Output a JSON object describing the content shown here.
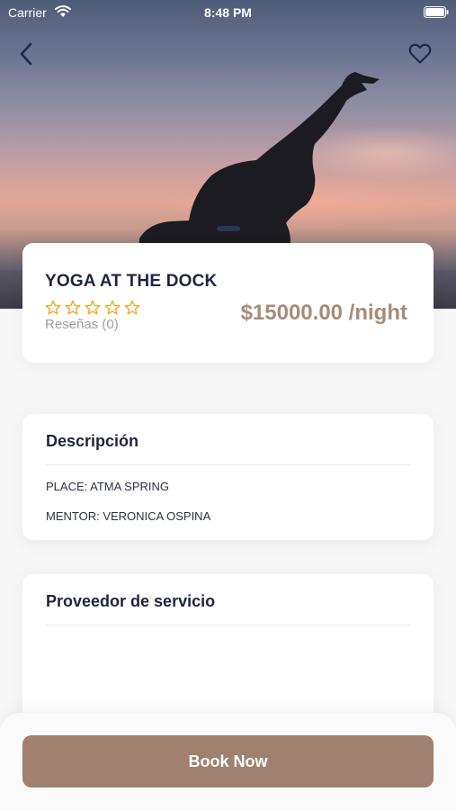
{
  "status_bar": {
    "carrier": "Carrier",
    "time": "8:48 PM",
    "wifi_icon": "wifi-icon",
    "battery_icon": "battery-icon"
  },
  "header": {
    "back_icon": "chevron-left-icon",
    "favorite_icon": "heart-outline-icon"
  },
  "hero": {
    "image": "yoga-silhouette-sunset",
    "pages_indicator": "page-1-active"
  },
  "event": {
    "title": "YOGA AT THE DOCK",
    "rating": 0,
    "rating_max": 5,
    "reviews_label": "Reseñas (0)",
    "price": "$15000.00 /night"
  },
  "description": {
    "title": "Descripción",
    "lines": [
      "PLACE: ATMA SPRING",
      "MENTOR: VERONICA OSPINA"
    ]
  },
  "provider": {
    "title": "Proveedor de servicio"
  },
  "actions": {
    "book_label": "Book Now"
  },
  "colors": {
    "accent": "#a0806e",
    "price": "#a78b7a",
    "title": "#1e2440",
    "star": "#f5a623"
  }
}
